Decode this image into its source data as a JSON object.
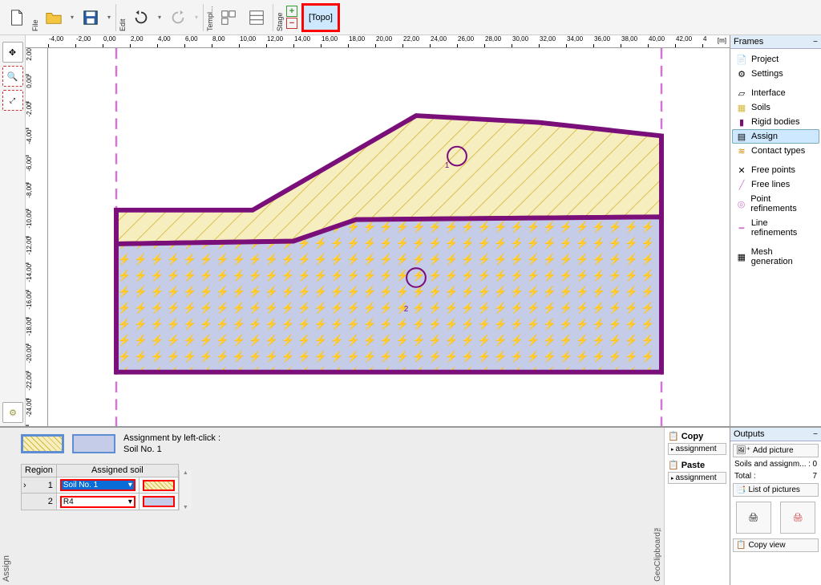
{
  "toolbar": {
    "file_label": "File",
    "edit_label": "Edit",
    "templ_label": "Templ...",
    "stage_label": "Stage",
    "topo_label": "[Topo]"
  },
  "ruler_x": [
    "-4,00",
    "-2,00",
    "0,00",
    "2,00",
    "4,00",
    "6,00",
    "8,00",
    "10,00",
    "12,00",
    "14,00",
    "16,00",
    "18,00",
    "20,00",
    "22,00",
    "24,00",
    "26,00",
    "28,00",
    "30,00",
    "32,00",
    "34,00",
    "36,00",
    "38,00",
    "40,00",
    "42,00",
    "4"
  ],
  "ruler_x_unit": "[m]",
  "ruler_y": [
    "2,00",
    "0,00",
    "-2,00",
    "-4,00",
    "-6,00",
    "-8,00",
    "-10,00",
    "-12,00",
    "-14,00",
    "-16,00",
    "-18,00",
    "-20,00",
    "-22,00",
    "-24,00"
  ],
  "region_labels": {
    "r1": "1",
    "r2": "2"
  },
  "frames": {
    "title": "Frames",
    "items": [
      {
        "label": "Project",
        "icon": "project-icon"
      },
      {
        "label": "Settings",
        "icon": "gear-icon"
      },
      {
        "label": "Interface",
        "icon": "interface-icon"
      },
      {
        "label": "Soils",
        "icon": "soils-icon"
      },
      {
        "label": "Rigid bodies",
        "icon": "rigid-icon"
      },
      {
        "label": "Assign",
        "icon": "assign-icon",
        "active": true
      },
      {
        "label": "Contact types",
        "icon": "contact-icon"
      },
      {
        "label": "Free points",
        "icon": "freepoints-icon"
      },
      {
        "label": "Free lines",
        "icon": "freelines-icon"
      },
      {
        "label": "Point refinements",
        "icon": "pointref-icon"
      },
      {
        "label": "Line refinements",
        "icon": "lineref-icon"
      },
      {
        "label": "Mesh generation",
        "icon": "mesh-icon"
      }
    ]
  },
  "assign": {
    "hint_line1": "Assignment by left-click :",
    "hint_line2": "Soil No. 1",
    "table": {
      "col_region": "Region",
      "col_assigned": "Assigned soil",
      "rows": [
        {
          "n": "1",
          "soil": "Soil No. 1"
        },
        {
          "n": "2",
          "soil": "R4"
        }
      ]
    },
    "side_label": "Assign"
  },
  "clipboard": {
    "copy_label": "Copy",
    "paste_label": "Paste",
    "assignment_label": "assignment",
    "side_label": "GeoClipboard™"
  },
  "outputs": {
    "title": "Outputs",
    "add_picture": "Add picture",
    "soils_line": "Soils and assignm... :",
    "soils_count": "0",
    "total_label": "Total :",
    "total_count": "7",
    "list_pictures": "List of pictures",
    "copy_view": "Copy view"
  }
}
